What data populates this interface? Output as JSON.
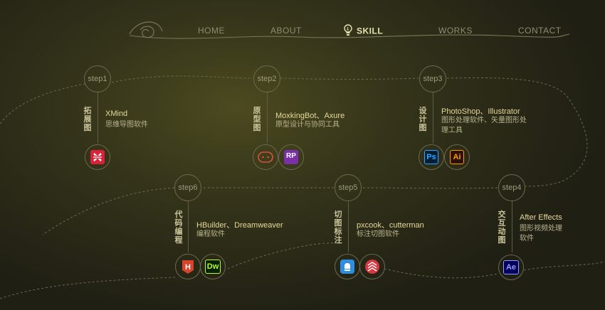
{
  "nav": {
    "home": "HOME",
    "about": "ABOUT",
    "skill": "SKILL",
    "works": "WORKS",
    "contact": "CONTACT"
  },
  "steps": [
    {
      "label": "step1",
      "category": "拓展图",
      "tools": "XMind",
      "desc": "思维导图软件"
    },
    {
      "label": "step2",
      "category": "原型图",
      "tools": "MoxkingBot、Axure",
      "desc": "原型设计与协同工具"
    },
    {
      "label": "step3",
      "category": "设计图",
      "tools": "PhotoShop、Illustrator",
      "desc_line1": "图形处理软件、矢量图形处",
      "desc_line2": "理工具"
    },
    {
      "label": "step4",
      "category": "交互动图",
      "tools": "After Effects",
      "desc_line1": "图形视频处理",
      "desc_line2": "软件"
    },
    {
      "label": "step5",
      "category": "切图标注",
      "tools": "pxcook、cutterman",
      "desc": "标注切图软件"
    },
    {
      "label": "step6",
      "category": "代码编程",
      "tools": "HBuilder、Dreamweaver",
      "desc": "编程软件"
    }
  ],
  "icons": {
    "ps": "Ps",
    "ai": "Ai",
    "rp": "RP",
    "dw": "Dw",
    "ae": "Ae",
    "h": "H"
  },
  "colors": {
    "accent": "#e6d89a",
    "line": "#6c6a4c",
    "xmind": "#d9223a",
    "axure": "#7b2fa8",
    "photoshop": "#31a8ff",
    "illustrator": "#ff9a00",
    "dreamweaver": "#bef734",
    "aftereffects": "#9999ff",
    "hbuilder": "#d6452b",
    "pxcook": "#2e8fe0",
    "cutterman": "#d8373e"
  }
}
